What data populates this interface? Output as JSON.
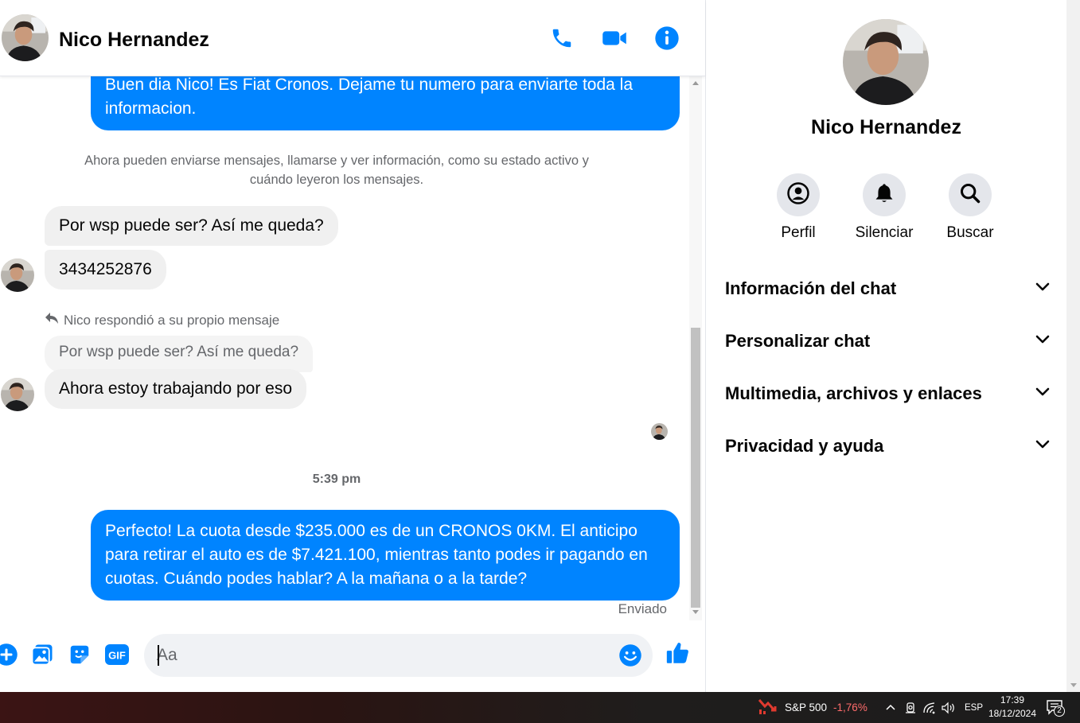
{
  "header": {
    "contact_name": "Nico Hernandez"
  },
  "messages": {
    "first_outgoing": "Buen dia Nico! Es Fiat Cronos. Dejame tu numero para enviarte toda la informacion.",
    "system_note": "Ahora pueden enviarse mensajes, llamarse y ver información, como su estado activo y cuándo leyeron los mensajes.",
    "incoming_1": "Por wsp puede ser? Así me queda?",
    "incoming_2": "3434252876",
    "reply_indicator": "Nico respondió a su propio mensaje",
    "quoted_message": "Por wsp puede ser? Así me queda?",
    "incoming_3": "Ahora estoy trabajando por eso",
    "timestamp": "5:39 pm",
    "last_outgoing": "Perfecto! La cuota desde $235.000 es de un CRONOS 0KM. El anticipo para retirar el auto es de $7.421.100, mientras tanto podes ir pagando en cuotas. Cuándo podes hablar? A la mañana o a la tarde?",
    "status": "Enviado"
  },
  "composer": {
    "placeholder": "Aa",
    "value": ""
  },
  "panel": {
    "contact_name": "Nico Hernandez",
    "actions": [
      {
        "label": "Perfil",
        "icon": "profile-icon"
      },
      {
        "label": "Silenciar",
        "icon": "bell-icon"
      },
      {
        "label": "Buscar",
        "icon": "search-icon"
      }
    ],
    "sections": [
      {
        "label": "Información del chat"
      },
      {
        "label": "Personalizar chat"
      },
      {
        "label": "Multimedia, archivos y enlaces"
      },
      {
        "label": "Privacidad y ayuda"
      }
    ]
  },
  "taskbar": {
    "stock_name": "S&P 500",
    "stock_change": "-1,76%",
    "language": "ESP",
    "time": "17:39",
    "date": "18/12/2024",
    "notification_count": "2"
  },
  "colors": {
    "accent": "#0084ff",
    "incoming_bubble": "#f0f0f0",
    "secondary_text": "#65676b",
    "stock_down": "#ff6b6b"
  }
}
